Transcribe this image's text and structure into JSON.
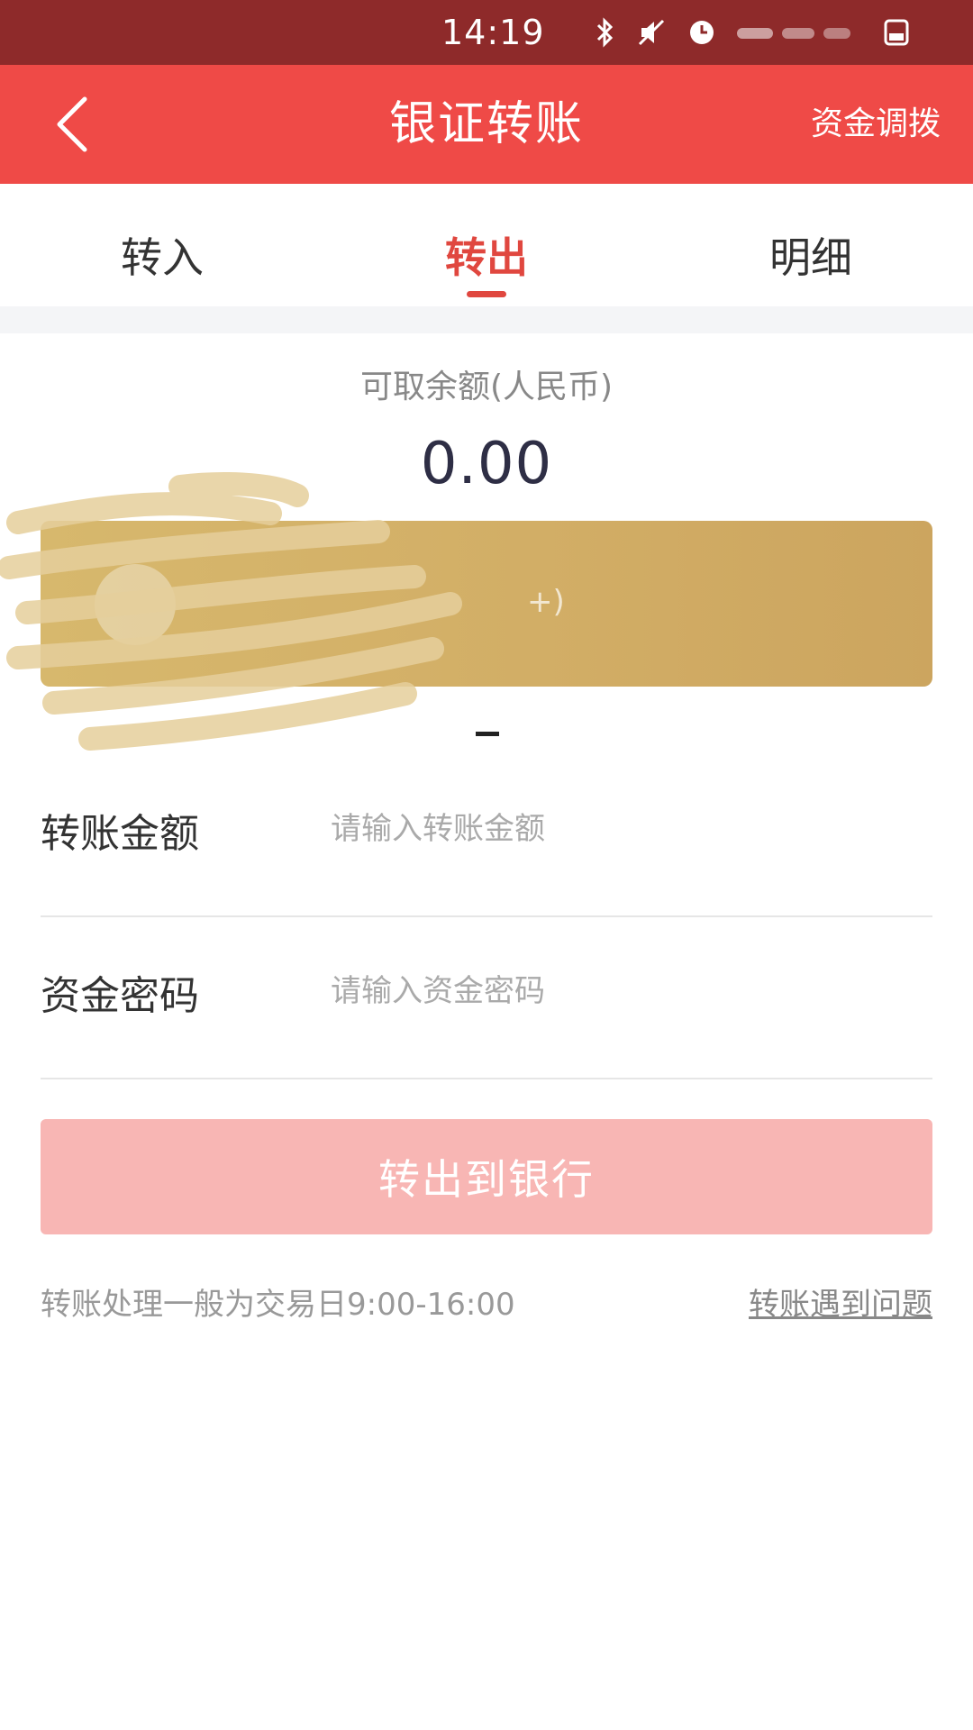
{
  "status_bar": {
    "time": "14:19"
  },
  "header": {
    "title": "银证转账",
    "right_action": "资金调拨"
  },
  "tabs": [
    {
      "label": "转入",
      "active": false
    },
    {
      "label": "转出",
      "active": true
    },
    {
      "label": "明细",
      "active": false
    }
  ],
  "balance": {
    "label": "可取余额(人民币)",
    "value": "0.00"
  },
  "form": {
    "amount": {
      "label": "转账金额",
      "placeholder": "请输入转账金额"
    },
    "password": {
      "label": "资金密码",
      "placeholder": "请输入资金密码"
    }
  },
  "submit": {
    "label": "转出到银行"
  },
  "footer": {
    "note": "转账处理一般为交易日9:00-16:00",
    "help": "转账遇到问题"
  },
  "colors": {
    "header": "#ef4a47",
    "status_bar": "#8e2a2a",
    "accent": "#e0473f",
    "card_gold": "#d2ae66",
    "button_disabled": "#f8b6b4"
  }
}
